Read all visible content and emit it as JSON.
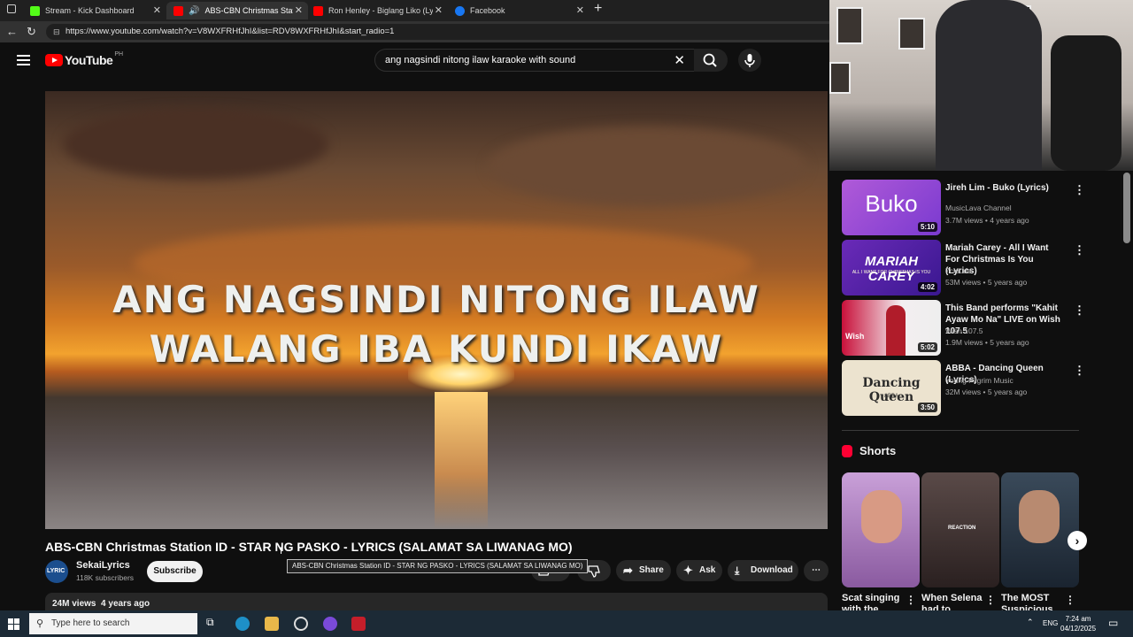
{
  "browser": {
    "tabs": [
      {
        "title": "Stream - Kick Dashboard",
        "favicon_color": "#53fc18"
      },
      {
        "title": "ABS-CBN Christmas Station",
        "favicon_color": "#ff0000"
      },
      {
        "title": "Ron Henley - Biglang Liko (Lyrics)",
        "favicon_color": "#ff0000"
      },
      {
        "title": "Facebook",
        "favicon_color": "#1877f2"
      }
    ],
    "url": "https://www.youtube.com/watch?v=V8WXFRHfJhI&list=RDV8WXFRHfJhI&start_radio=1"
  },
  "youtube": {
    "logo_text": "YouTube",
    "country_code": "PH",
    "search_query": "ang nagsindi nitong ilaw karaoke with sound"
  },
  "video": {
    "lyrics_line1": "ANG NAGSINDI NITONG ILAW",
    "lyrics_line2": "WALANG IBA KUNDI IKAW",
    "title": "ABS-CBN Christmas Station ID - STAR NG PASKO - LYRICS (SALAMAT SA LIWANAG MO)",
    "tooltip": "ABS-CBN Christmas Station ID - STAR NG PASKO - LYRICS (SALAMAT SA LIWANAG MO)",
    "channel": "SekaiLyrics",
    "avatar_text": "LYRIC",
    "subscribers": "118K subscribers",
    "subscribe_label": "Subscribe",
    "share_label": "Share",
    "ask_label": "Ask",
    "download_label": "Download",
    "views": "24M views",
    "age": "4 years ago"
  },
  "recommendations": [
    {
      "title": "Jireh Lim - Buko (Lyrics)",
      "channel": "MusicLava Channel",
      "meta": "3.7M views • 4 years ago",
      "duration": "5:10",
      "thumb_text": "Buko"
    },
    {
      "title": "Mariah Carey - All I Want For Christmas Is You (Lyrics)",
      "channel": "7clouds",
      "meta": "53M views • 5 years ago",
      "duration": "4:02",
      "thumb_text": "MARIAH CAREY",
      "thumb_sub": "ALL I WANT FOR CHRISTMAS IS YOU"
    },
    {
      "title": "This Band performs \"Kahit Ayaw Mo Na\" LIVE on Wish 107.5",
      "channel": "Wish 107.5",
      "meta": "1.9M views • 5 years ago",
      "duration": "5:02",
      "thumb_text": "Wish"
    },
    {
      "title": "ABBA - Dancing Queen (Lyrics)",
      "channel": "Young Pilgrim Music",
      "meta": "32M views • 5 years ago",
      "duration": "3:50",
      "thumb_text": "Dancing Queen",
      "thumb_sub": "ABBA"
    }
  ],
  "shorts": {
    "heading": "Shorts",
    "items": [
      {
        "title": "Scat singing with the"
      },
      {
        "title": "When Selena had to",
        "badge": "REACTION"
      },
      {
        "title": "The MOST Suspicious"
      }
    ]
  },
  "taskbar": {
    "search_placeholder": "Type here to search",
    "language": "ENG",
    "time": "7:24 am",
    "date": "04/12/2025"
  }
}
